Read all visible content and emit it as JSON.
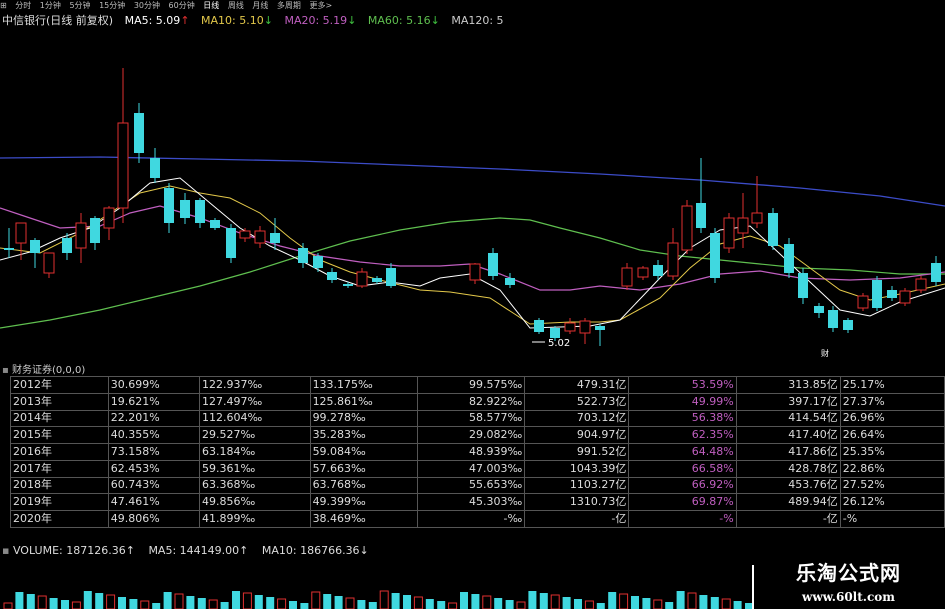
{
  "toolbar": {
    "items": [
      "⊞",
      "分时",
      "1分钟",
      "5分钟",
      "15分钟",
      "30分钟",
      "60分钟",
      "日线",
      "周线",
      "月线",
      "多周期",
      "更多>"
    ]
  },
  "kline": {
    "title": "中信银行(日线 前复权)",
    "ma5": "MA5: 5.09",
    "ma10": "MA10: 5.10",
    "ma20": "MA20: 5.19",
    "ma60": "MA60: 5.16",
    "ma120": "MA120: 5",
    "low_label": "5.02",
    "marker": "财",
    "colors": {
      "ma5": "#ffffff",
      "ma10": "#e3c84a",
      "ma20": "#c05fc0",
      "ma60": "#5fbf4f",
      "ma120": "#3c4cc8",
      "up": "#e03030",
      "down": "#40d8e0"
    }
  },
  "financial": {
    "header": "财务证券(0,0,0)",
    "rows": [
      [
        "2012年",
        "30.699%",
        "122.937‰",
        "133.175‰",
        "99.575‰",
        "479.31亿",
        "53.59%",
        "313.85亿",
        "25.17%"
      ],
      [
        "2013年",
        "19.621%",
        "127.497‰",
        "125.861‰",
        "82.922‰",
        "522.73亿",
        "49.99%",
        "397.17亿",
        "27.37%"
      ],
      [
        "2014年",
        "22.201%",
        "112.604‰",
        "99.278‰",
        "58.577‰",
        "703.12亿",
        "56.38%",
        "414.54亿",
        "26.96%"
      ],
      [
        "2015年",
        "40.355%",
        "29.527‰",
        "35.283‰",
        "29.082‰",
        "904.97亿",
        "62.35%",
        "417.40亿",
        "26.64%"
      ],
      [
        "2016年",
        "73.158%",
        "63.184‰",
        "59.084‰",
        "48.939‰",
        "991.52亿",
        "64.48%",
        "417.86亿",
        "25.35%"
      ],
      [
        "2017年",
        "62.453%",
        "59.361‰",
        "57.663‰",
        "47.003‰",
        "1043.39亿",
        "66.58%",
        "428.78亿",
        "22.86%"
      ],
      [
        "2018年",
        "60.743%",
        "63.368‰",
        "63.768‰",
        "55.653‰",
        "1103.27亿",
        "66.92%",
        "453.76亿",
        "27.52%"
      ],
      [
        "2019年",
        "47.461%",
        "49.856‰",
        "49.399‰",
        "45.303‰",
        "1310.73亿",
        "69.87%",
        "489.94亿",
        "26.12%"
      ],
      [
        "2020年",
        "49.806%",
        "41.899‰",
        "38.469‰",
        "-‰",
        "-亿",
        "-%",
        "-亿",
        "-%"
      ]
    ]
  },
  "volume": {
    "label": "VOLUME: 187126.36↑",
    "ma5": "MA5: 144149.00↑",
    "ma10": "MA10: 186766.36↓"
  },
  "watermark": {
    "title": "乐淘公式网",
    "url": "www.60lt.com"
  }
}
